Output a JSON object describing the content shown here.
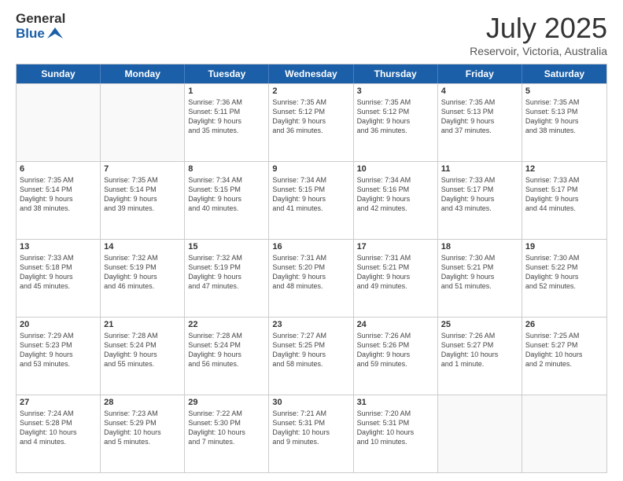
{
  "header": {
    "logo_line1": "General",
    "logo_line2": "Blue",
    "month": "July 2025",
    "location": "Reservoir, Victoria, Australia"
  },
  "weekdays": [
    "Sunday",
    "Monday",
    "Tuesday",
    "Wednesday",
    "Thursday",
    "Friday",
    "Saturday"
  ],
  "rows": [
    [
      {
        "day": "",
        "info": ""
      },
      {
        "day": "",
        "info": ""
      },
      {
        "day": "1",
        "info": "Sunrise: 7:36 AM\nSunset: 5:11 PM\nDaylight: 9 hours\nand 35 minutes."
      },
      {
        "day": "2",
        "info": "Sunrise: 7:35 AM\nSunset: 5:12 PM\nDaylight: 9 hours\nand 36 minutes."
      },
      {
        "day": "3",
        "info": "Sunrise: 7:35 AM\nSunset: 5:12 PM\nDaylight: 9 hours\nand 36 minutes."
      },
      {
        "day": "4",
        "info": "Sunrise: 7:35 AM\nSunset: 5:13 PM\nDaylight: 9 hours\nand 37 minutes."
      },
      {
        "day": "5",
        "info": "Sunrise: 7:35 AM\nSunset: 5:13 PM\nDaylight: 9 hours\nand 38 minutes."
      }
    ],
    [
      {
        "day": "6",
        "info": "Sunrise: 7:35 AM\nSunset: 5:14 PM\nDaylight: 9 hours\nand 38 minutes."
      },
      {
        "day": "7",
        "info": "Sunrise: 7:35 AM\nSunset: 5:14 PM\nDaylight: 9 hours\nand 39 minutes."
      },
      {
        "day": "8",
        "info": "Sunrise: 7:34 AM\nSunset: 5:15 PM\nDaylight: 9 hours\nand 40 minutes."
      },
      {
        "day": "9",
        "info": "Sunrise: 7:34 AM\nSunset: 5:15 PM\nDaylight: 9 hours\nand 41 minutes."
      },
      {
        "day": "10",
        "info": "Sunrise: 7:34 AM\nSunset: 5:16 PM\nDaylight: 9 hours\nand 42 minutes."
      },
      {
        "day": "11",
        "info": "Sunrise: 7:33 AM\nSunset: 5:17 PM\nDaylight: 9 hours\nand 43 minutes."
      },
      {
        "day": "12",
        "info": "Sunrise: 7:33 AM\nSunset: 5:17 PM\nDaylight: 9 hours\nand 44 minutes."
      }
    ],
    [
      {
        "day": "13",
        "info": "Sunrise: 7:33 AM\nSunset: 5:18 PM\nDaylight: 9 hours\nand 45 minutes."
      },
      {
        "day": "14",
        "info": "Sunrise: 7:32 AM\nSunset: 5:19 PM\nDaylight: 9 hours\nand 46 minutes."
      },
      {
        "day": "15",
        "info": "Sunrise: 7:32 AM\nSunset: 5:19 PM\nDaylight: 9 hours\nand 47 minutes."
      },
      {
        "day": "16",
        "info": "Sunrise: 7:31 AM\nSunset: 5:20 PM\nDaylight: 9 hours\nand 48 minutes."
      },
      {
        "day": "17",
        "info": "Sunrise: 7:31 AM\nSunset: 5:21 PM\nDaylight: 9 hours\nand 49 minutes."
      },
      {
        "day": "18",
        "info": "Sunrise: 7:30 AM\nSunset: 5:21 PM\nDaylight: 9 hours\nand 51 minutes."
      },
      {
        "day": "19",
        "info": "Sunrise: 7:30 AM\nSunset: 5:22 PM\nDaylight: 9 hours\nand 52 minutes."
      }
    ],
    [
      {
        "day": "20",
        "info": "Sunrise: 7:29 AM\nSunset: 5:23 PM\nDaylight: 9 hours\nand 53 minutes."
      },
      {
        "day": "21",
        "info": "Sunrise: 7:28 AM\nSunset: 5:24 PM\nDaylight: 9 hours\nand 55 minutes."
      },
      {
        "day": "22",
        "info": "Sunrise: 7:28 AM\nSunset: 5:24 PM\nDaylight: 9 hours\nand 56 minutes."
      },
      {
        "day": "23",
        "info": "Sunrise: 7:27 AM\nSunset: 5:25 PM\nDaylight: 9 hours\nand 58 minutes."
      },
      {
        "day": "24",
        "info": "Sunrise: 7:26 AM\nSunset: 5:26 PM\nDaylight: 9 hours\nand 59 minutes."
      },
      {
        "day": "25",
        "info": "Sunrise: 7:26 AM\nSunset: 5:27 PM\nDaylight: 10 hours\nand 1 minute."
      },
      {
        "day": "26",
        "info": "Sunrise: 7:25 AM\nSunset: 5:27 PM\nDaylight: 10 hours\nand 2 minutes."
      }
    ],
    [
      {
        "day": "27",
        "info": "Sunrise: 7:24 AM\nSunset: 5:28 PM\nDaylight: 10 hours\nand 4 minutes."
      },
      {
        "day": "28",
        "info": "Sunrise: 7:23 AM\nSunset: 5:29 PM\nDaylight: 10 hours\nand 5 minutes."
      },
      {
        "day": "29",
        "info": "Sunrise: 7:22 AM\nSunset: 5:30 PM\nDaylight: 10 hours\nand 7 minutes."
      },
      {
        "day": "30",
        "info": "Sunrise: 7:21 AM\nSunset: 5:31 PM\nDaylight: 10 hours\nand 9 minutes."
      },
      {
        "day": "31",
        "info": "Sunrise: 7:20 AM\nSunset: 5:31 PM\nDaylight: 10 hours\nand 10 minutes."
      },
      {
        "day": "",
        "info": ""
      },
      {
        "day": "",
        "info": ""
      }
    ]
  ]
}
